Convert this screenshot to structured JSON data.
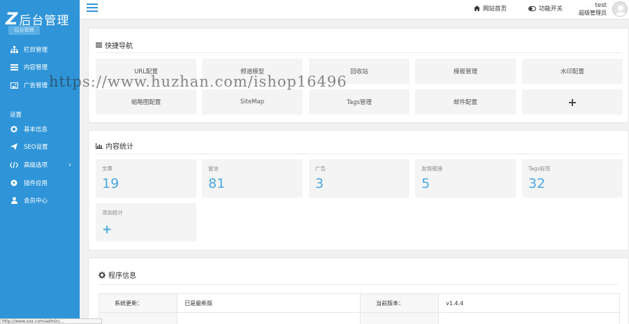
{
  "brand": {
    "logo_letter": "Z",
    "title": "后台管理",
    "badge": "后台管理"
  },
  "sidebar": {
    "items": [
      {
        "label": "栏目管理",
        "icon": "sitemap-icon"
      },
      {
        "label": "内容管理",
        "icon": "list-icon"
      },
      {
        "label": "广告管理",
        "icon": "image-icon"
      }
    ],
    "section_title": "设置",
    "settings_items": [
      {
        "label": "基本信息",
        "icon": "gear-icon"
      },
      {
        "label": "SEO设置",
        "icon": "paper-plane-icon"
      },
      {
        "label": "高级选项",
        "icon": "code-icon",
        "arrow": "›"
      },
      {
        "label": "插件应用",
        "icon": "soccer-ball-icon"
      },
      {
        "label": "会员中心",
        "icon": "user-icon"
      }
    ]
  },
  "topbar": {
    "home_link": "网站首页",
    "feature_toggle": "功能开关",
    "user_name": "test",
    "user_role": "超级管理员"
  },
  "quick_nav": {
    "title": "快捷导航",
    "items": [
      "URL配置",
      "频道模型",
      "回收站",
      "模板管理",
      "水印配置",
      "缩略图配置",
      "SiteMap",
      "Tags管理",
      "邮件配置",
      "+"
    ]
  },
  "stats": {
    "title": "内容统计",
    "items": [
      {
        "label": "文章",
        "value": "19"
      },
      {
        "label": "留言",
        "value": "81"
      },
      {
        "label": "广告",
        "value": "3"
      },
      {
        "label": "友情链接",
        "value": "5"
      },
      {
        "label": "Tags标签",
        "value": "32"
      }
    ],
    "add_label": "添加统计",
    "add_symbol": "+"
  },
  "program_info": {
    "title": "程序信息",
    "rows": [
      {
        "k1": "系统更新：",
        "v1": "已是最新版",
        "k2": "当前版本：",
        "v2": "v1.4.4"
      }
    ]
  },
  "watermark": "https://www.huzhan.com/ishop16496",
  "statusbar": "http://www.xxx.com/admin/..."
}
